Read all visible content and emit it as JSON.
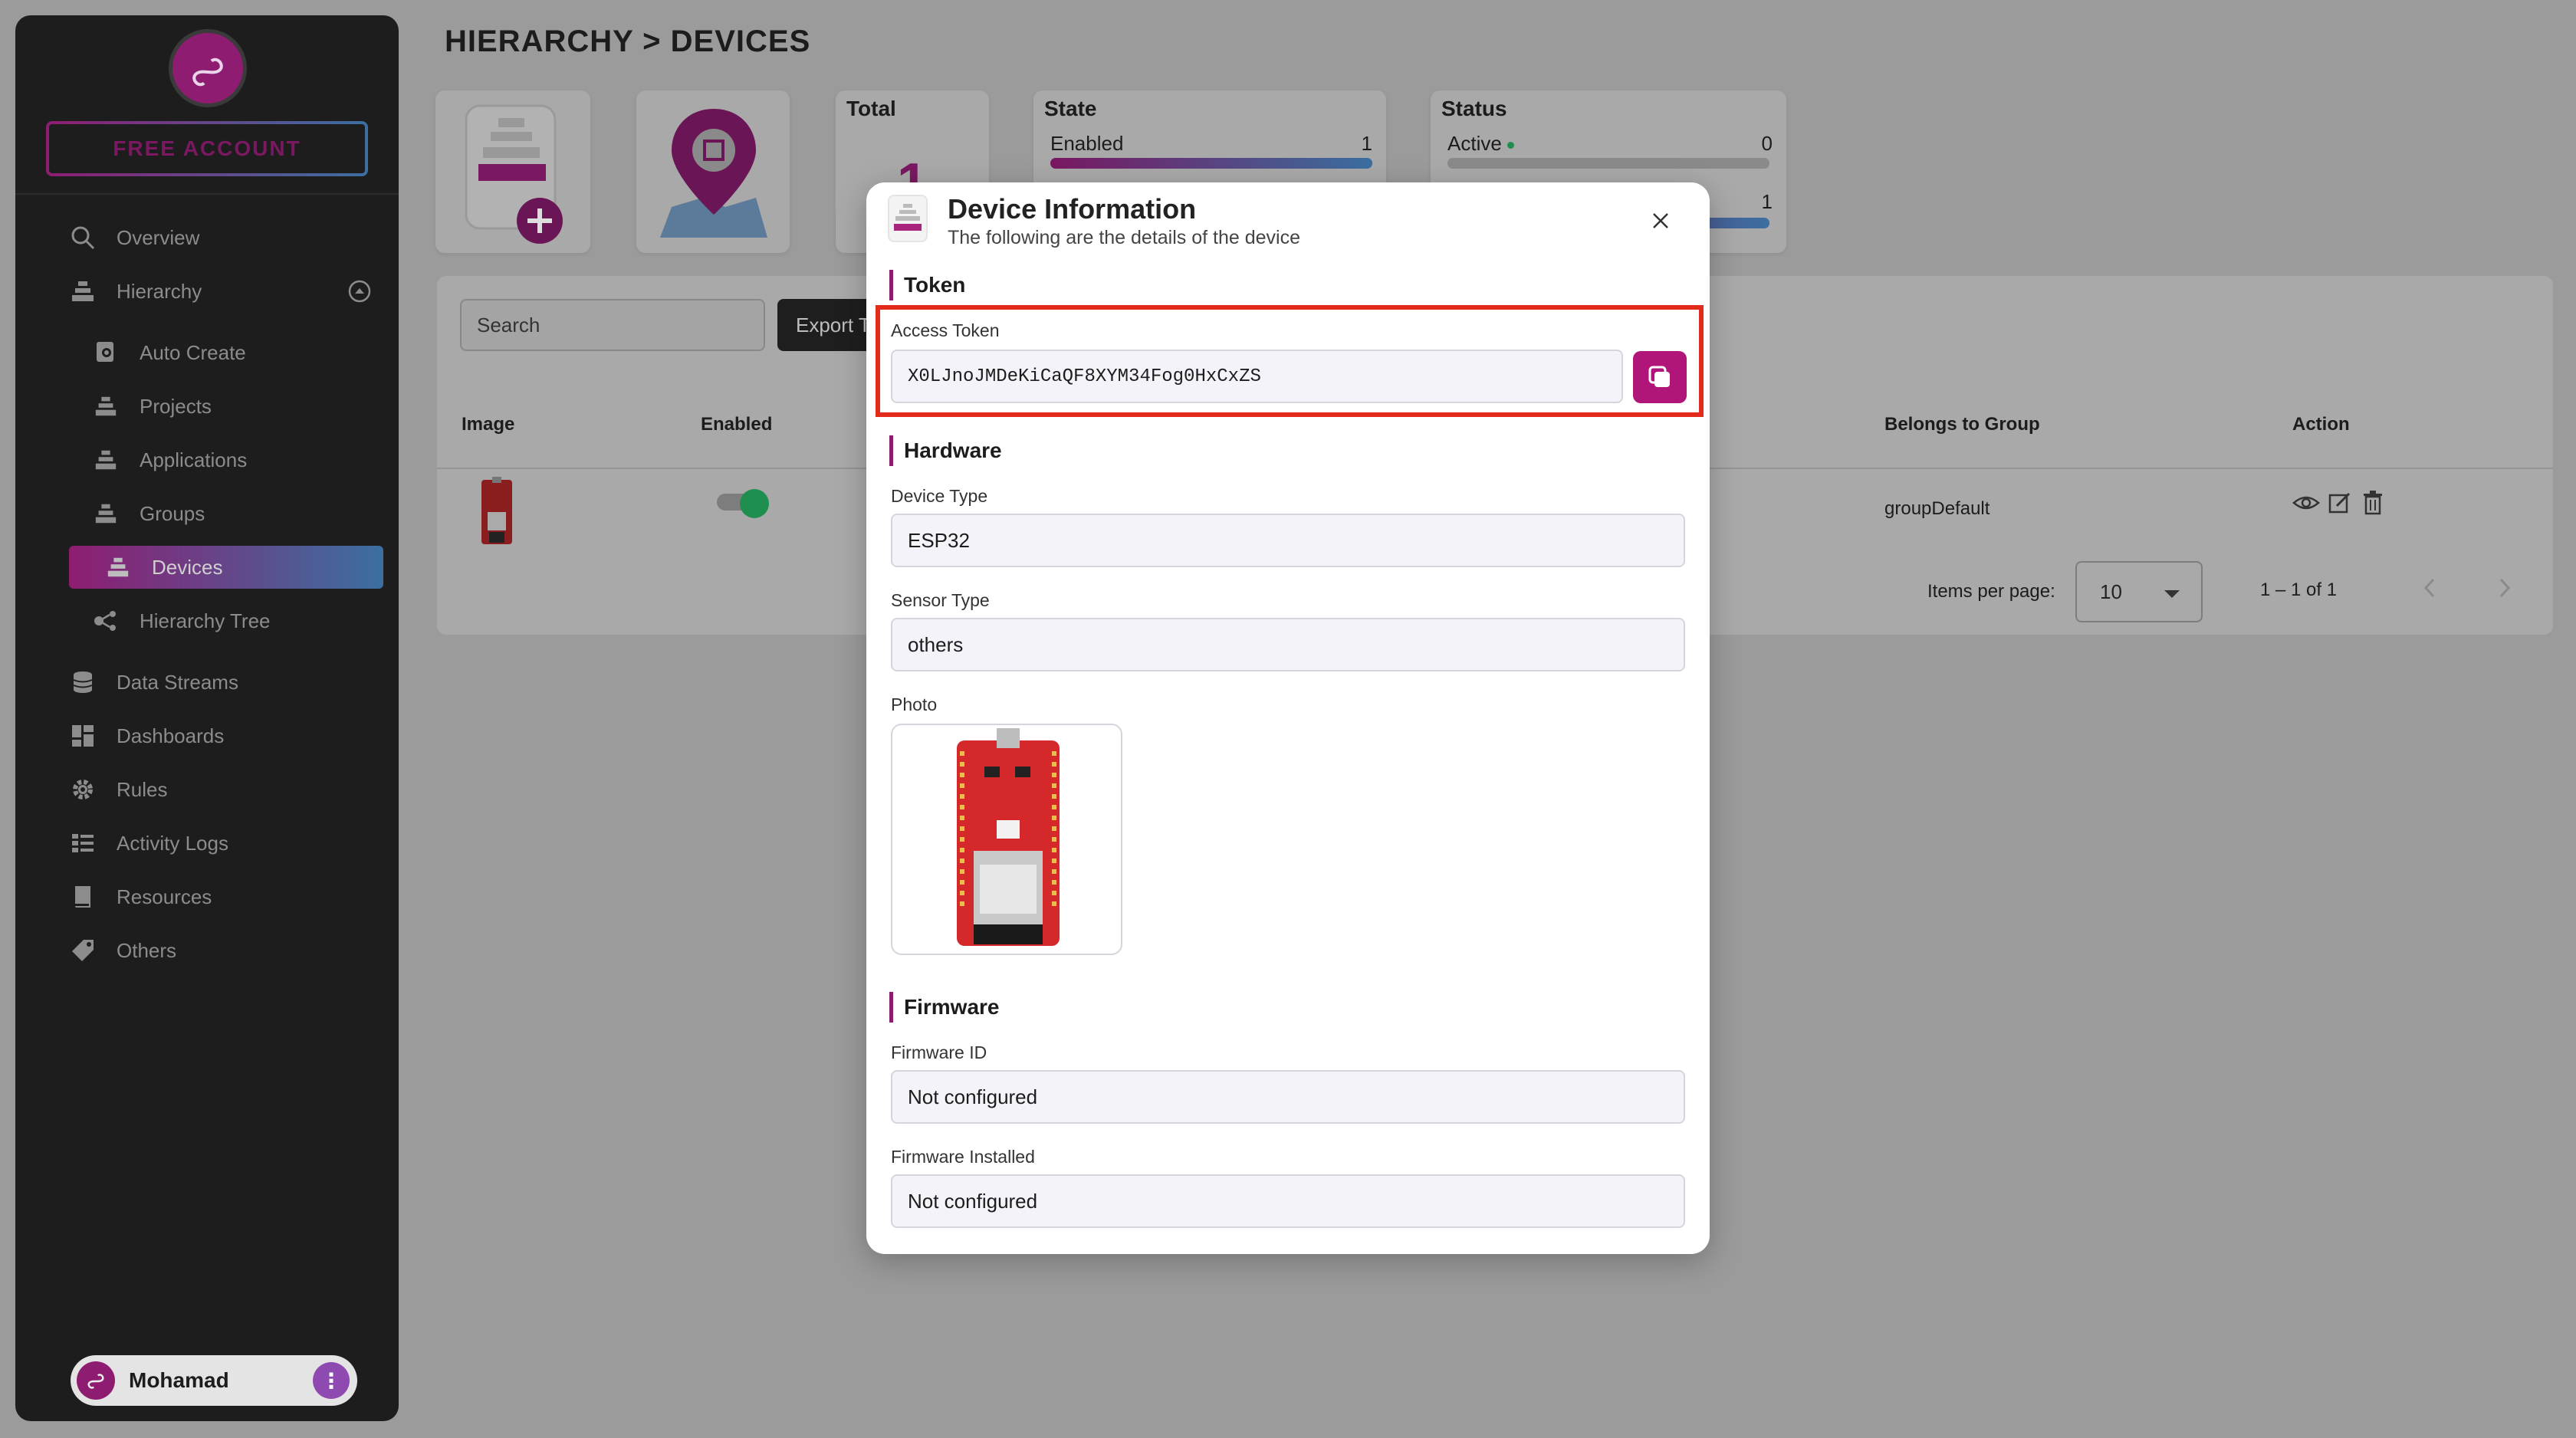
{
  "sidebar": {
    "account_label": "FREE ACCOUNT",
    "items": [
      {
        "label": "Overview"
      },
      {
        "label": "Hierarchy"
      },
      {
        "label": "Auto Create"
      },
      {
        "label": "Projects"
      },
      {
        "label": "Applications"
      },
      {
        "label": "Groups"
      },
      {
        "label": "Devices"
      },
      {
        "label": "Hierarchy Tree"
      },
      {
        "label": "Data Streams"
      },
      {
        "label": "Dashboards"
      },
      {
        "label": "Rules"
      },
      {
        "label": "Activity Logs"
      },
      {
        "label": "Resources"
      },
      {
        "label": "Others"
      }
    ],
    "active_item": "Devices",
    "user_name": "Mohamad"
  },
  "page": {
    "title": "HIERARCHY > DEVICES"
  },
  "stats": {
    "total_title": "Total",
    "total_value": "1",
    "state_title": "State",
    "state_enabled_label": "Enabled",
    "state_enabled_value": "1",
    "state_enabled_fraction": 1.0,
    "status_title": "Status",
    "status_active_label": "Active",
    "status_active_value": "0",
    "status_active_fraction": 0.0,
    "status_second_value": "1",
    "status_second_fraction": 1.0
  },
  "table": {
    "search_placeholder": "Search",
    "export_label": "Export T",
    "headers": {
      "image": "Image",
      "enabled": "Enabled",
      "group": "Belongs to Group",
      "action": "Action"
    },
    "rows": [
      {
        "enabled": true,
        "group": "groupDefault"
      }
    ],
    "items_per_page_label": "Items per page:",
    "items_per_page_value": "10",
    "range_label": "1 – 1 of 1"
  },
  "modal": {
    "title": "Device Information",
    "subtitle": "The following are the details of the device",
    "token_section": "Token",
    "access_token_label": "Access Token",
    "access_token_value": "X0LJnoJMDeKiCaQF8XYM34Fog0HxCxZS",
    "hardware_section": "Hardware",
    "device_type_label": "Device Type",
    "device_type_value": "ESP32",
    "sensor_type_label": "Sensor Type",
    "sensor_type_value": "others",
    "photo_label": "Photo",
    "firmware_section": "Firmware",
    "firmware_id_label": "Firmware ID",
    "firmware_id_value": "Not configured",
    "firmware_installed_label": "Firmware Installed",
    "firmware_installed_value": "Not configured"
  },
  "colors": {
    "brand": "#8e1d72",
    "brand_gradient_end": "#3b6fa0",
    "highlight": "#e32b1c",
    "active_green": "#1e8f4e"
  }
}
